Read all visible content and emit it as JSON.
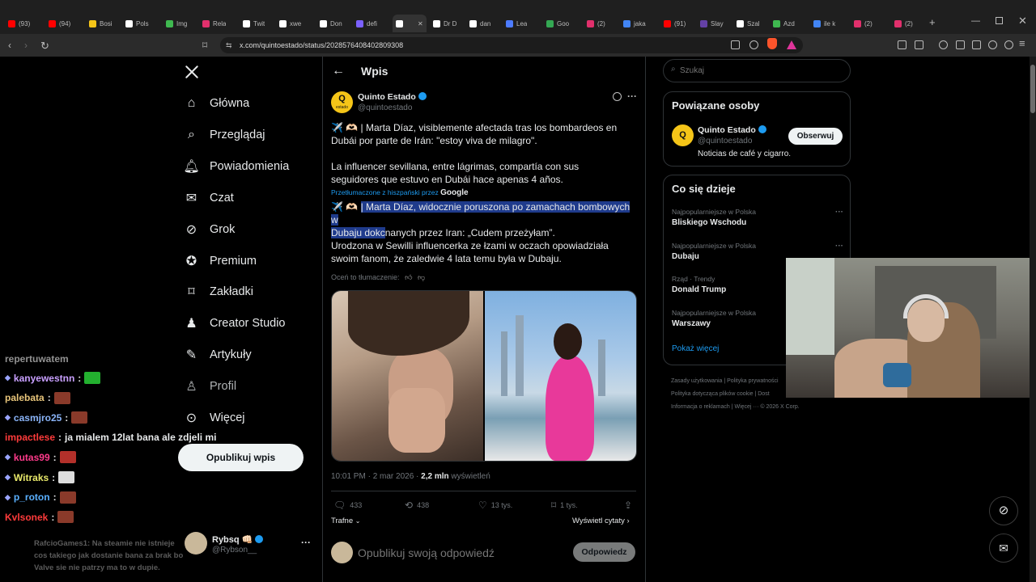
{
  "browser": {
    "tabs": [
      {
        "label": "(93)",
        "color": "#ff0000"
      },
      {
        "label": "(94)",
        "color": "#ff0000"
      },
      {
        "label": "Bosi",
        "color": "#f5c518"
      },
      {
        "label": "Pols",
        "color": "#ffffff"
      },
      {
        "label": "Img",
        "color": "#3fb950"
      },
      {
        "label": "Rela",
        "color": "#e1306c"
      },
      {
        "label": "Twit",
        "color": "#ffffff"
      },
      {
        "label": "xwe",
        "color": "#ffffff"
      },
      {
        "label": "Don",
        "color": "#ffffff"
      },
      {
        "label": "defi",
        "color": "#7b61ff"
      },
      {
        "label": "",
        "color": "#ffffff"
      },
      {
        "label": "Dr D",
        "color": "#ffffff"
      },
      {
        "label": "dan",
        "color": "#ffffff"
      },
      {
        "label": "Lea",
        "color": "#4d7cff"
      },
      {
        "label": "Goo",
        "color": "#34a853"
      },
      {
        "label": "(2)",
        "color": "#e1306c"
      },
      {
        "label": "jaka",
        "color": "#4285f4"
      },
      {
        "label": "(91)",
        "color": "#ff0000"
      },
      {
        "label": "Slay",
        "color": "#6441a5"
      },
      {
        "label": "Szal",
        "color": "#ffffff"
      },
      {
        "label": "Azd",
        "color": "#3fb950"
      },
      {
        "label": "ile k",
        "color": "#4285f4"
      },
      {
        "label": "(2)",
        "color": "#e1306c"
      },
      {
        "label": "(2)",
        "color": "#e1306c"
      }
    ],
    "url": "x.com/quintoestado/status/2028576408402809308"
  },
  "nav": {
    "items": [
      {
        "label": "Główna",
        "icon": "home-icon"
      },
      {
        "label": "Przeglądaj",
        "icon": "search-icon"
      },
      {
        "label": "Powiadomienia",
        "icon": "bell-icon"
      },
      {
        "label": "Czat",
        "icon": "mail-icon"
      },
      {
        "label": "Grok",
        "icon": "grok-icon"
      },
      {
        "label": "Premium",
        "icon": "premium-icon"
      },
      {
        "label": "Zakładki",
        "icon": "bookmark-icon"
      },
      {
        "label": "Creator Studio",
        "icon": "creator-icon"
      },
      {
        "label": "Artykuły",
        "icon": "article-icon"
      },
      {
        "label": "Profil",
        "icon": "profile-icon"
      },
      {
        "label": "Więcej",
        "icon": "more-icon"
      }
    ],
    "post_button": "Opublikuj wpis",
    "account": {
      "name": "Rybsq 👊🏻",
      "handle": "@Rybson__"
    }
  },
  "post": {
    "header_title": "Wpis",
    "author_name": "Quinto Estado",
    "author_handle": "@quintoestado",
    "avatar_text": "Q",
    "avatar_sub": "estado",
    "text_original_1": "✈️ 🫶🏻 | Marta Díaz, visiblemente afectada tras los bombardeos en Dubái por parte de Irán: \"estoy viva de milagro\".",
    "text_original_2": "La influencer sevillana, entre lágrimas, compartía con sus seguidores que estuvo en Dubái hace apenas 4 años.",
    "translated_by": "Przetłumaczone z hiszpański przez",
    "translator": "Google",
    "text_translated_sel_1": "| Marta Díaz, widocznie poruszona po zamachach bombowych w",
    "text_translated_sel_2": "Dubaju dokc",
    "text_translated_rest": "nanych przez Iran: „Cudem przeżyłam”.",
    "text_translated_icons": "✈️ 🫶🏻",
    "text_translated_2": "Urodzona w Sewilli influencerka ze łzami w oczach opowiadziała swoim fanom, że zaledwie 4 lata temu była w Dubaju.",
    "rate_translation": "Oceń to tłumaczenie:",
    "timestamp": "10:01 PM · 2 mar 2026 · ",
    "views_count": "2,2 mln",
    "views_label": " wyświetleń",
    "stats": {
      "replies": "433",
      "reposts": "438",
      "likes": "13 tys.",
      "bookmarks": "1 tys."
    },
    "sort_label": "Trafne",
    "quotes_link": "Wyświetl cytaty",
    "reply_placeholder": "Opublikuj swoją odpowiedź",
    "reply_button": "Odpowiedz"
  },
  "sidebar": {
    "search_placeholder": "Szukaj",
    "related_title": "Powiązane osoby",
    "related_name": "Quinto Estado",
    "related_handle": "@quintoestado",
    "related_bio": "Noticias de café y cigarro.",
    "follow_button": "Obserwuj",
    "trends_title": "Co się dzieje",
    "trends": [
      {
        "sub": "Najpopularniejsze w Polska",
        "main": "Bliskiego Wschodu"
      },
      {
        "sub": "Najpopularniejsze w Polska",
        "main": "Dubaju"
      },
      {
        "sub": "Rząd · Trendy",
        "main": "Donald Trump"
      },
      {
        "sub": "Najpopularniejsze w Polska",
        "main": "Warszawy"
      }
    ],
    "show_more": "Pokaż więcej",
    "footer_1": "Zasady użytkowania  |  Polityka prywatności",
    "footer_2": "Polityka dotycząca plików cookie  |  Dost",
    "footer_3": "Informacja o reklamach  |  Więcej ···   © 2026 X Corp."
  },
  "chat": {
    "partial_top": "repertuwatem",
    "messages": [
      {
        "user": "kanyewestnn",
        "text": "",
        "color": "#c9a0ff",
        "emote": "#23b02f"
      },
      {
        "user": "palebata",
        "text": "",
        "color": "#e8c57a",
        "emote": "#8a3a2a"
      },
      {
        "user": "casmjro25",
        "text": "",
        "color": "#8ab4f8",
        "emote": "#8a3a2a"
      },
      {
        "user": "impactlese",
        "text": "ja mialem 12lat bana ale zdjeli mi",
        "color": "#ff3b3b",
        "emote": ""
      },
      {
        "user": "kutas99",
        "text": "",
        "color": "#ff3b8b",
        "emote": "#b3302a"
      },
      {
        "user": "Witraks",
        "text": "",
        "color": "#e8e86a",
        "emote": "#dddddd"
      },
      {
        "user": "p_roton",
        "text": "",
        "color": "#5ab0ff",
        "emote": "#8a3a2a"
      },
      {
        "user": "Kvlsonek",
        "text": "",
        "color": "#ff3b3b",
        "emote": "#8a3a2a"
      }
    ],
    "faded_message": "RafcioGames1: Na steamie nie istnieje cos takiego jak dostanie bana za brak bo Valve sie nie patrzy ma to w dupie."
  },
  "colors": {
    "accent": "#1d9bf0",
    "brand": "#f5c518",
    "selection": "#1f3b8c"
  }
}
